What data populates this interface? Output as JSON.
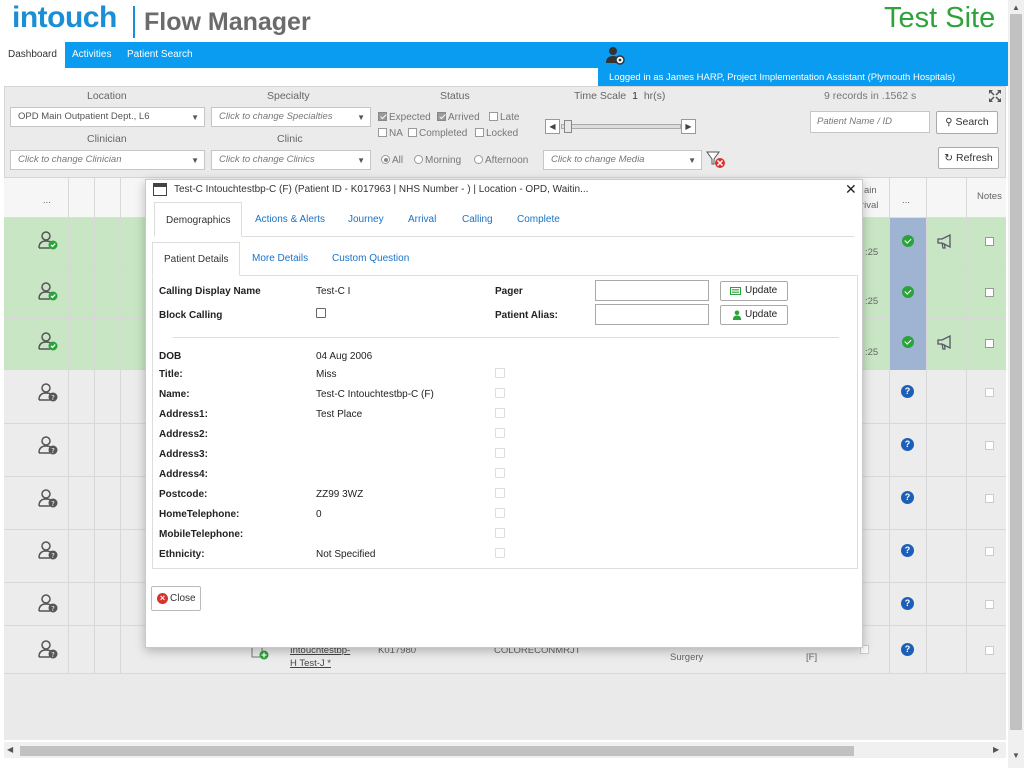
{
  "header": {
    "logo_intouch": "intouch",
    "logo_flow": "Flow Manager",
    "site_name": "Test Site"
  },
  "nav": {
    "tabs": [
      {
        "label": "Dashboard",
        "active": true
      },
      {
        "label": "Activities",
        "active": false
      },
      {
        "label": "Patient Search",
        "active": false
      }
    ],
    "logged_in_text": "Logged in as James HARP, Project Implementation Assistant (Plymouth Hospitals)"
  },
  "filters": {
    "location_label": "Location",
    "location_value": "OPD Main Outpatient Dept., L6",
    "specialty_label": "Specialty",
    "specialty_placeholder": "Click to change Specialties",
    "status_label": "Status",
    "status_options": [
      {
        "label": "Expected",
        "checked": true
      },
      {
        "label": "Arrived",
        "checked": true
      },
      {
        "label": "Late",
        "checked": false
      },
      {
        "label": "NA",
        "checked": false
      },
      {
        "label": "Completed",
        "checked": false
      },
      {
        "label": "Locked",
        "checked": false
      }
    ],
    "time_scale_label": "Time Scale",
    "time_scale_value": "1",
    "time_scale_unit": "hr(s)",
    "records_text": "9 records in .1562 s",
    "clinician_label": "Clinician",
    "clinician_placeholder": "Click to change Clinician",
    "clinic_label": "Clinic",
    "clinic_placeholder": "Click to change Clinics",
    "period_options": [
      {
        "label": "All",
        "checked": true
      },
      {
        "label": "Morning",
        "checked": false
      },
      {
        "label": "Afternoon",
        "checked": false
      }
    ],
    "media_placeholder": "Click to change Media",
    "patient_search_placeholder": "Patient Name / ID",
    "search_button": "Search",
    "refresh_button": "Refresh"
  },
  "table": {
    "header_dots_1": "...",
    "header_dots_2": "...",
    "header_arrival_1": "ain",
    "header_arrival_2": "rival",
    "header_notes": "Notes",
    "time_suffix": ":25",
    "last_row": {
      "name_line1": "Intouchtestbp-",
      "name_line2": "H Test-J *",
      "id": "K017980",
      "clinic": "COLORECONMRJT",
      "specialty": "Surgery",
      "flag": "[F]"
    }
  },
  "modal": {
    "title": "Test-C Intouchtestbp-C (F) (Patient ID - K017963 | NHS Number - ) | Location - OPD, Waitin...",
    "tabs": [
      {
        "label": "Demographics",
        "active": true
      },
      {
        "label": "Actions & Alerts",
        "active": false
      },
      {
        "label": "Journey",
        "active": false
      },
      {
        "label": "Arrival",
        "active": false
      },
      {
        "label": "Calling",
        "active": false
      },
      {
        "label": "Complete",
        "active": false
      }
    ],
    "subtabs": [
      {
        "label": "Patient Details",
        "active": true
      },
      {
        "label": "More Details",
        "active": false
      },
      {
        "label": "Custom Question",
        "active": false
      }
    ],
    "calling_display_name_label": "Calling Display Name",
    "calling_display_name_value": "Test-C I",
    "block_calling_label": "Block Calling",
    "pager_label": "Pager",
    "pager_value": "",
    "patient_alias_label": "Patient Alias:",
    "patient_alias_value": "",
    "update_button": "Update",
    "fields": [
      {
        "label": "DOB",
        "value": "04 Aug 2006"
      },
      {
        "label": "Title:",
        "value": "Miss"
      },
      {
        "label": "Name:",
        "value": "Test-C Intouchtestbp-C (F)"
      },
      {
        "label": "Address1:",
        "value": "Test Place"
      },
      {
        "label": "Address2:",
        "value": ""
      },
      {
        "label": "Address3:",
        "value": ""
      },
      {
        "label": "Address4:",
        "value": ""
      },
      {
        "label": "Postcode:",
        "value": "ZZ99 3WZ"
      },
      {
        "label": "HomeTelephone:",
        "value": "0"
      },
      {
        "label": "MobileTelephone:",
        "value": ""
      },
      {
        "label": "Ethnicity:",
        "value": "Not Specified"
      }
    ],
    "close_button": "Close"
  },
  "colors": {
    "brand_blue": "#0a9cf0",
    "logo_blue": "#1a8fd6",
    "site_green": "#2fa33b",
    "row_green": "#c8e6c4",
    "link_blue": "#1a73c8",
    "close_red": "#d9322b"
  },
  "icons": [
    "user-check-icon",
    "user-question-icon",
    "gear-user-icon",
    "megaphone-icon",
    "question-icon",
    "check-circle-icon",
    "filter-clear-icon",
    "search-icon",
    "refresh-icon",
    "expand-icon",
    "window-icon",
    "close-icon",
    "pager-icon",
    "person-icon"
  ]
}
